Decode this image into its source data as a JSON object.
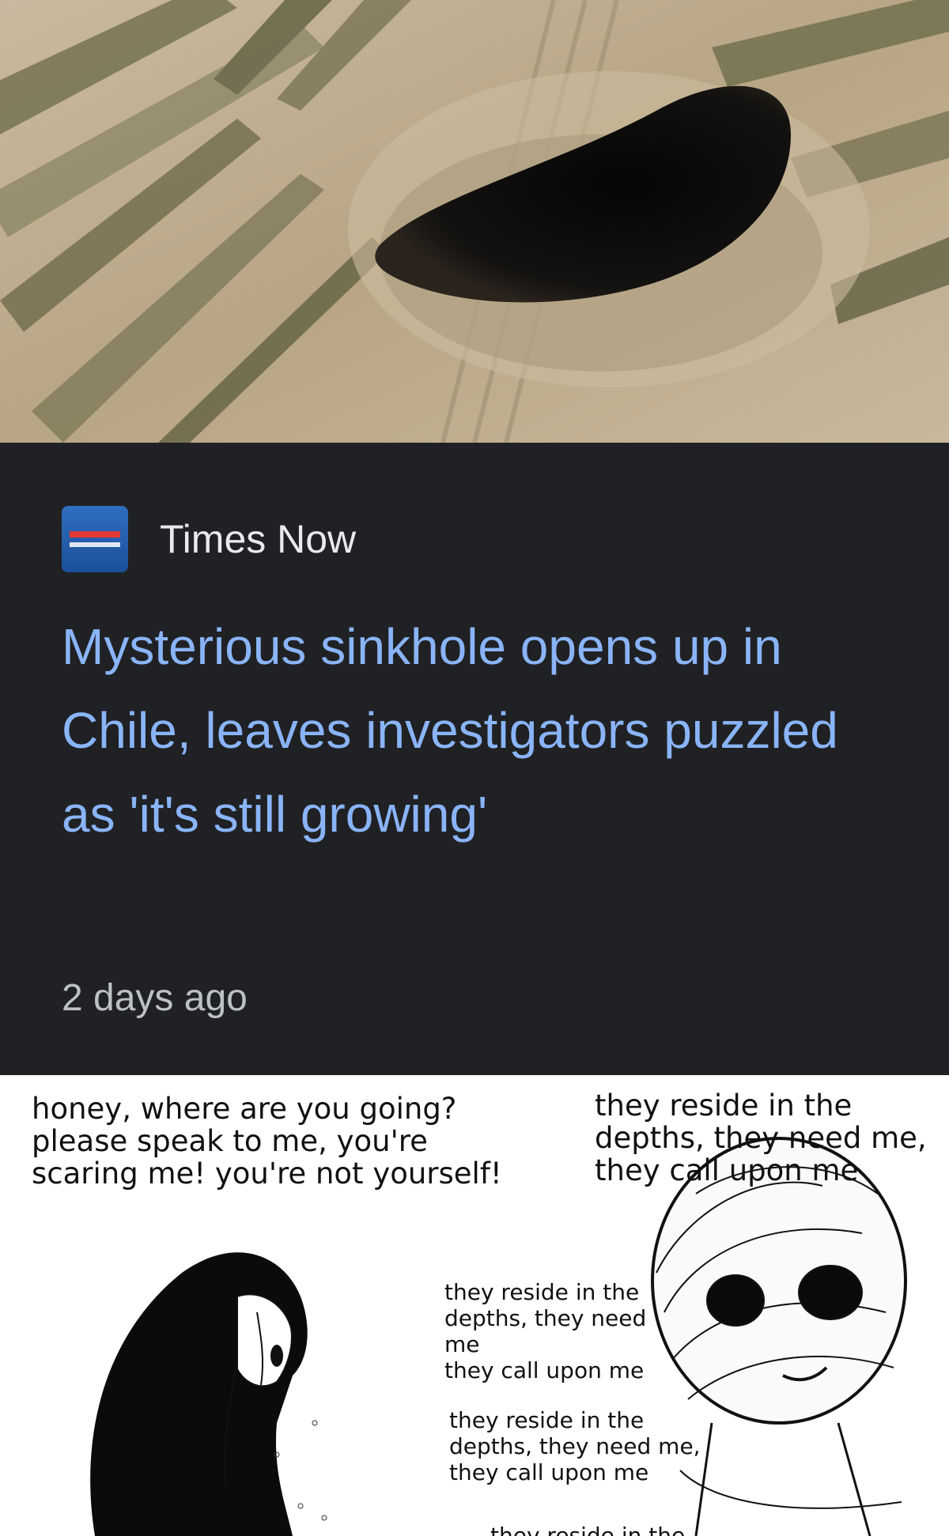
{
  "photo": {
    "subject": "aerial view of a dark sinkhole in a dry field"
  },
  "news_card": {
    "source_name": "Times Now",
    "source_icon": "times-now-logo",
    "headline": "Mysterious sinkhole opens up in Chile, leaves investigators puzzled as 'it's still growing'",
    "timestamp": "2 days ago",
    "colors": {
      "card_bg": "#202124",
      "headline": "#8ab4f8",
      "source_name": "#e8eaed",
      "timestamp": "#bdc1c6"
    }
  },
  "comic": {
    "woman_caption": "honey, where are you going?\nplease speak to me, you're\nscaring me! you're not yourself!",
    "man_caption": "they reside in the\ndepths, they need me,\nthey call upon me",
    "echo_1": "they reside in the\ndepths, they need me\nthey call upon me",
    "echo_2": "they reside in the\ndepths, they need me,\nthey call upon me",
    "echo_3": "they reside in the"
  }
}
